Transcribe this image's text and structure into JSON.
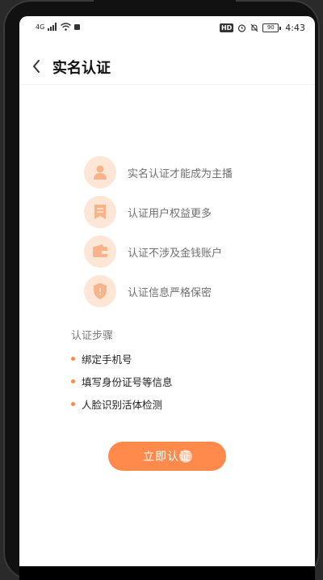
{
  "status": {
    "signal": "4G",
    "hd": "HD",
    "battery": "90",
    "time": "4:43"
  },
  "header": {
    "title": "实名认证"
  },
  "benefits": [
    {
      "icon": "user-icon",
      "text": "实名认证才能成为主播"
    },
    {
      "icon": "bookmark-icon",
      "text": "认证用户权益更多"
    },
    {
      "icon": "wallet-icon",
      "text": "认证不涉及金钱账户"
    },
    {
      "icon": "shield-icon",
      "text": "认证信息严格保密"
    }
  ],
  "steps": {
    "title": "认证步骤",
    "items": [
      "绑定手机号",
      "填写身份证号等信息",
      "人脸识别活体检测"
    ]
  },
  "cta": {
    "label": "立即认证"
  },
  "colors": {
    "accent": "#ff8a4c",
    "icon_bg": "#fde6d6",
    "icon_fg": "#f7b48a"
  }
}
